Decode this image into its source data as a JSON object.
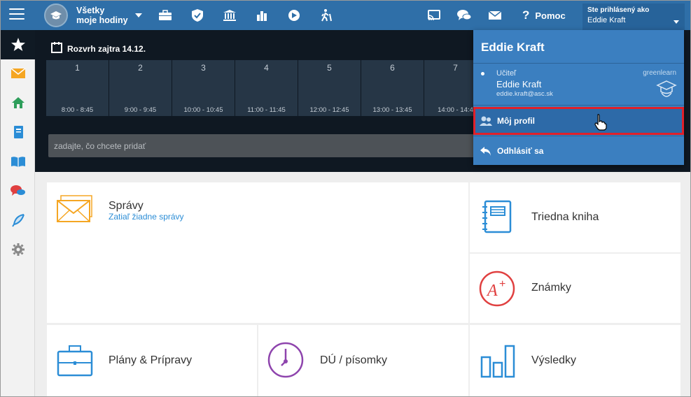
{
  "topbar": {
    "class_selector": {
      "line1": "Všetky",
      "line2": "moje hodiny"
    },
    "icons": [
      "briefcase-icon",
      "shield-icon",
      "bank-icon",
      "bar-chart-icon",
      "compass-icon",
      "hiking-icon",
      "cast-icon",
      "chat-icon",
      "mail-icon"
    ],
    "help_label": "Pomoc",
    "user_box": {
      "signed_in_label": "Ste prihlásený ako",
      "name": "Eddie Kraft"
    }
  },
  "timetable": {
    "title": "Rozvrh zajtra 14.12.",
    "periods": [
      {
        "num": "1",
        "time": "8:00 - 8:45"
      },
      {
        "num": "2",
        "time": "9:00 - 9:45"
      },
      {
        "num": "3",
        "time": "10:00 - 10:45"
      },
      {
        "num": "4",
        "time": "11:00 - 11:45"
      },
      {
        "num": "5",
        "time": "12:00 - 12:45"
      },
      {
        "num": "6",
        "time": "13:00 - 13:45"
      },
      {
        "num": "7",
        "time": "14:00 - 14:4"
      }
    ],
    "add_placeholder": "zadajte, čo chcete pridať"
  },
  "tiles": {
    "spravy": {
      "label": "Správy",
      "sub": "Zatiaľ žiadne správy"
    },
    "triedna": {
      "label": "Triedna kniha"
    },
    "znamky": {
      "label": "Známky"
    },
    "plany": {
      "label": "Plány & Prípravy"
    },
    "du": {
      "label": "DÚ / písomky"
    },
    "vysledky": {
      "label": "Výsledky"
    }
  },
  "dropdown": {
    "name": "Eddie Kraft",
    "role": "Učiteľ",
    "school": "greenlearn",
    "user_name": "Eddie Kraft",
    "email": "eddie.kraft@asc.sk",
    "profile_label": "Môj profil",
    "logout_label": "Odhlásiť sa"
  },
  "colors": {
    "topbar": "#2f6fa8",
    "dropdown": "#3b7fc0",
    "highlight": "#e0202a",
    "timetable_bg": "#0f1822"
  }
}
